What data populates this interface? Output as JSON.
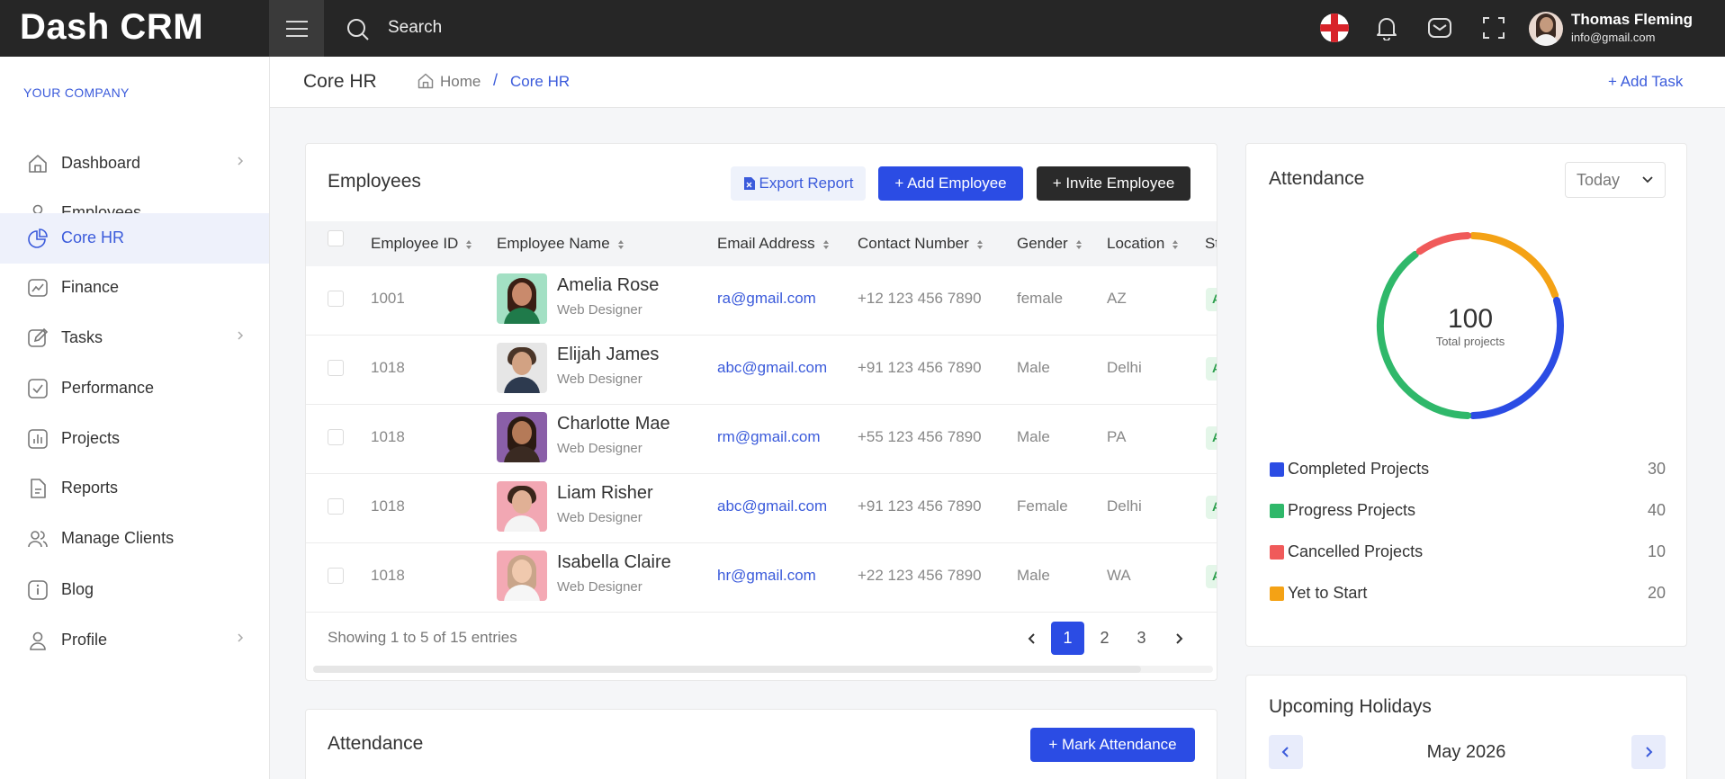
{
  "app": {
    "brand": "Dash CRM",
    "search_label": "Search",
    "user_name": "Thomas Fleming",
    "user_email": "info@gmail.com"
  },
  "sidebar": {
    "company": "YOUR COMPANY",
    "items": [
      {
        "label": "Dashboard",
        "icon": "home-icon",
        "has_chevron": true
      },
      {
        "label": "Employees",
        "icon": "user-icon",
        "has_chevron": false
      },
      {
        "label": "Core HR",
        "icon": "pie-chart-icon",
        "has_chevron": false,
        "active": true
      },
      {
        "label": "Finance",
        "icon": "trending-icon",
        "has_chevron": false
      },
      {
        "label": "Tasks",
        "icon": "edit-icon",
        "has_chevron": true
      },
      {
        "label": "Performance",
        "icon": "check-square-icon",
        "has_chevron": false
      },
      {
        "label": "Projects",
        "icon": "bar-chart-icon",
        "has_chevron": false
      },
      {
        "label": "Reports",
        "icon": "file-text-icon",
        "has_chevron": false
      },
      {
        "label": "Manage Clients",
        "icon": "users-icon",
        "has_chevron": false
      },
      {
        "label": "Blog",
        "icon": "info-icon",
        "has_chevron": false
      },
      {
        "label": "Profile",
        "icon": "user-icon",
        "has_chevron": true
      }
    ]
  },
  "header": {
    "title": "Core HR",
    "breadcrumb_home": "Home",
    "breadcrumb_sep": "/",
    "breadcrumb_current": "Core HR",
    "add_task": "+ Add Task"
  },
  "employees": {
    "title": "Employees",
    "export_label": "Export Report",
    "add_label": "+ Add Employee",
    "invite_label": "+ Invite Employee",
    "columns": [
      "Employee ID",
      "Employee Name",
      "Email Address",
      "Contact Number",
      "Gender",
      "Location",
      "St"
    ],
    "rows": [
      {
        "id": "1001",
        "name": "Amelia Rose",
        "role": "Web Designer",
        "email": "ra@gmail.com",
        "phone": "+12 123 456 7890",
        "gender": "female",
        "location": "AZ",
        "status": "A"
      },
      {
        "id": "1018",
        "name": "Elijah James",
        "role": "Web Designer",
        "email": "abc@gmail.com",
        "phone": "+91 123 456 7890",
        "gender": "Male",
        "location": "Delhi",
        "status": "A"
      },
      {
        "id": "1018",
        "name": "Charlotte Mae",
        "role": "Web Designer",
        "email": "rm@gmail.com",
        "phone": "+55 123 456 7890",
        "gender": "Male",
        "location": "PA",
        "status": "A"
      },
      {
        "id": "1018",
        "name": "Liam Risher",
        "role": "Web Designer",
        "email": "abc@gmail.com",
        "phone": "+91 123 456 7890",
        "gender": "Female",
        "location": "Delhi",
        "status": "A"
      },
      {
        "id": "1018",
        "name": "Isabella Claire",
        "role": "Web Designer",
        "email": "hr@gmail.com",
        "phone": "+22 123 456 7890",
        "gender": "Male",
        "location": "WA",
        "status": "A"
      }
    ],
    "showing": "Showing 1 to 5 of 15 entries",
    "pages": [
      "1",
      "2",
      "3"
    ],
    "current_page": "1"
  },
  "attendance_panel": {
    "title": "Attendance",
    "filter": "Today",
    "total": "100",
    "total_label": "Total projects",
    "legend": [
      {
        "label": "Completed Projects",
        "value": 30,
        "color": "#2b4ce4"
      },
      {
        "label": "Progress Projects",
        "value": 40,
        "color": "#2fb86a"
      },
      {
        "label": "Cancelled Projects",
        "value": 10,
        "color": "#f05a5a"
      },
      {
        "label": "Yet to Start",
        "value": 20,
        "color": "#f4a215"
      }
    ]
  },
  "attendance_section": {
    "title": "Attendance",
    "mark_label": "+ Mark Attendance"
  },
  "holidays": {
    "title": "Upcoming Holidays",
    "month": "May 2026"
  }
}
